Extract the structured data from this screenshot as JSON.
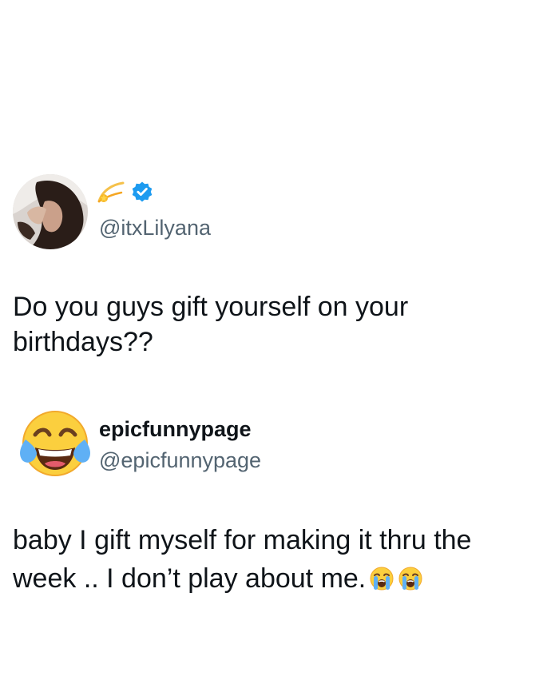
{
  "tweet": {
    "author_handle": "@itxLilyana",
    "text": "Do you guys gift yourself on your birthdays??",
    "badge_icons": [
      "comet-emoji-icon",
      "verified-badge-icon"
    ]
  },
  "reply": {
    "display_name": "epicfunnypage",
    "handle": "@epicfunnypage",
    "text": "baby I gift myself for making it thru the week .. I don’t play about me.",
    "trailing_emojis": [
      "loudly-crying-face-icon",
      "loudly-crying-face-icon"
    ]
  },
  "colors": {
    "text_primary": "#0f1419",
    "text_secondary": "#536471",
    "verified_blue": "#1d9bf0"
  }
}
